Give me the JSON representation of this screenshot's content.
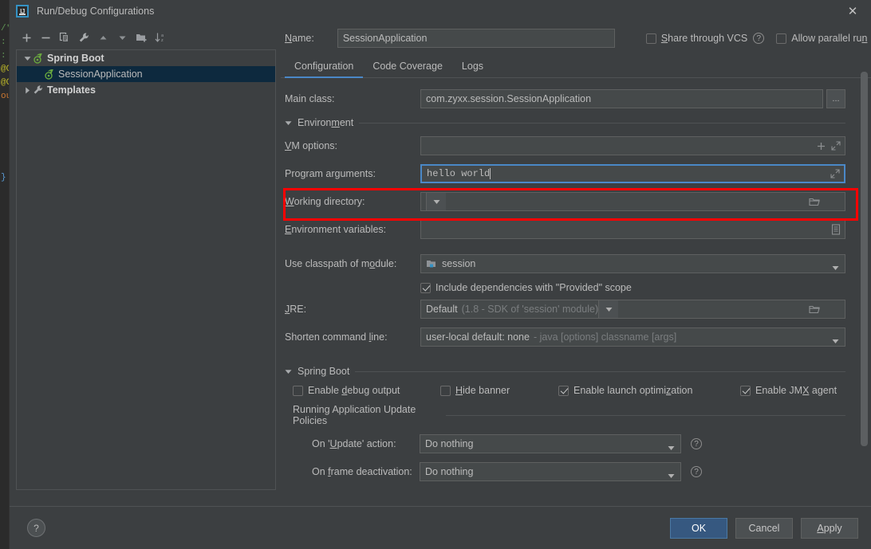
{
  "window": {
    "title": "Run/Debug Configurations",
    "logo_text": "IJ",
    "close_icon": "close-icon"
  },
  "tree_toolbar": [
    {
      "name": "add-configuration-button",
      "icon": "plus-icon"
    },
    {
      "name": "remove-configuration-button",
      "icon": "minus-icon"
    },
    {
      "name": "copy-configuration-button",
      "icon": "copy-icon"
    },
    {
      "name": "edit-templates-button",
      "icon": "wrench-icon"
    },
    {
      "name": "move-up-button",
      "icon": "arrow-up-icon"
    },
    {
      "name": "move-down-button",
      "icon": "arrow-down-icon"
    },
    {
      "name": "create-folder-button",
      "icon": "folder-add-icon"
    },
    {
      "name": "sort-configurations-button",
      "icon": "sort-az-icon"
    }
  ],
  "tree": {
    "items": [
      {
        "label": "Spring Boot",
        "icon": "spring-boot-icon",
        "expanded": true,
        "level": 0,
        "bold": true,
        "selected": false,
        "has_toggle": true
      },
      {
        "label": "SessionApplication",
        "icon": "spring-boot-icon",
        "level": 1,
        "bold": false,
        "selected": true,
        "has_toggle": false
      },
      {
        "label": "Templates",
        "icon": "wrench-icon",
        "expanded": false,
        "level": 0,
        "bold": true,
        "selected": false,
        "has_toggle": true
      }
    ]
  },
  "header": {
    "name_label": "Name:",
    "name_label_mnemonic": "N",
    "name_value": "SessionApplication",
    "name_placeholder": "",
    "share_vcs_label": "Share through VCS",
    "share_vcs_mnemonic": "S",
    "share_vcs_checked": false,
    "share_vcs_help_icon": "help-icon",
    "allow_parallel_label": "Allow parallel run",
    "allow_parallel_mnemonic": "n",
    "allow_parallel_checked": false
  },
  "tabs": [
    {
      "label": "Configuration",
      "active": true
    },
    {
      "label": "Code Coverage",
      "active": false
    },
    {
      "label": "Logs",
      "active": false
    }
  ],
  "form": {
    "main_class": {
      "label": "Main class:",
      "value": "com.zyxx.session.SessionApplication",
      "browse_label": "..."
    },
    "environment_section": {
      "label": "Environment",
      "mnemonic": "m",
      "expanded": true,
      "toggle_icon": "chevron-down-icon"
    },
    "vm_options": {
      "label": "VM options:",
      "mnemonic": "V",
      "value": "",
      "icons": [
        "plus-icon",
        "expand-icon"
      ]
    },
    "program_arguments": {
      "label": "Program arguments:",
      "mnemonic": "g",
      "value": "hello world",
      "focused": true,
      "icons": [
        "expand-icon"
      ],
      "highlighted": true
    },
    "working_directory": {
      "label": "Working directory:",
      "mnemonic": "W",
      "value": "",
      "icons": [
        "folder-icon",
        "chevron-down-icon"
      ]
    },
    "environment_variables": {
      "label": "Environment variables:",
      "mnemonic": "E",
      "value": "",
      "icons": [
        "list-icon"
      ]
    },
    "classpath_module": {
      "label": "Use classpath of module:",
      "mnemonic": "o",
      "value": "session",
      "icon": "module-icon"
    },
    "include_provided": {
      "label": "Include dependencies with \"Provided\" scope",
      "checked": true
    },
    "jre": {
      "label": "JRE:",
      "mnemonic": "J",
      "value": "Default",
      "value_hint": "(1.8 - SDK of 'session' module)",
      "icons": [
        "folder-icon",
        "chevron-down-icon"
      ]
    },
    "shorten_command_line": {
      "label": "Shorten command line:",
      "mnemonic": "l",
      "value": "user-local default: none",
      "value_hint": "- java [options] classname [args]"
    },
    "spring_boot_section": {
      "label": "Spring Boot",
      "mnemonic": "g",
      "expanded": true,
      "toggle_icon": "chevron-down-icon"
    },
    "spring_checkboxes": [
      {
        "label": "Enable debug output",
        "mnemonic": "d",
        "checked": false
      },
      {
        "label": "Hide banner",
        "mnemonic": "H",
        "checked": false
      },
      {
        "label": "Enable launch optimization",
        "mnemonic": "z",
        "checked": true
      },
      {
        "label": "Enable JMX agent",
        "mnemonic": "X",
        "checked": true
      }
    ],
    "update_policies_section": {
      "label": "Running Application Update Policies"
    },
    "on_update_action": {
      "label": "On 'Update' action:",
      "mnemonic": "U",
      "value": "Do nothing",
      "help_icon": "help-icon"
    },
    "on_frame_deactivation": {
      "label": "On frame deactivation:",
      "mnemonic": "f",
      "value": "Do nothing",
      "help_icon": "help-icon"
    }
  },
  "footer": {
    "help_label": "?",
    "ok_label": "OK",
    "cancel_label": "Cancel",
    "apply_label": "Apply"
  },
  "colors": {
    "dialog_bg": "#3c3f41",
    "field_bg": "#45494a",
    "accent_blue": "#4a88c7",
    "primary_button": "#365880",
    "selection_blue": "#0d293e",
    "annotation_red": "#ff0000",
    "text": "#bbbbbb",
    "dim_text": "#7a7d7f"
  }
}
